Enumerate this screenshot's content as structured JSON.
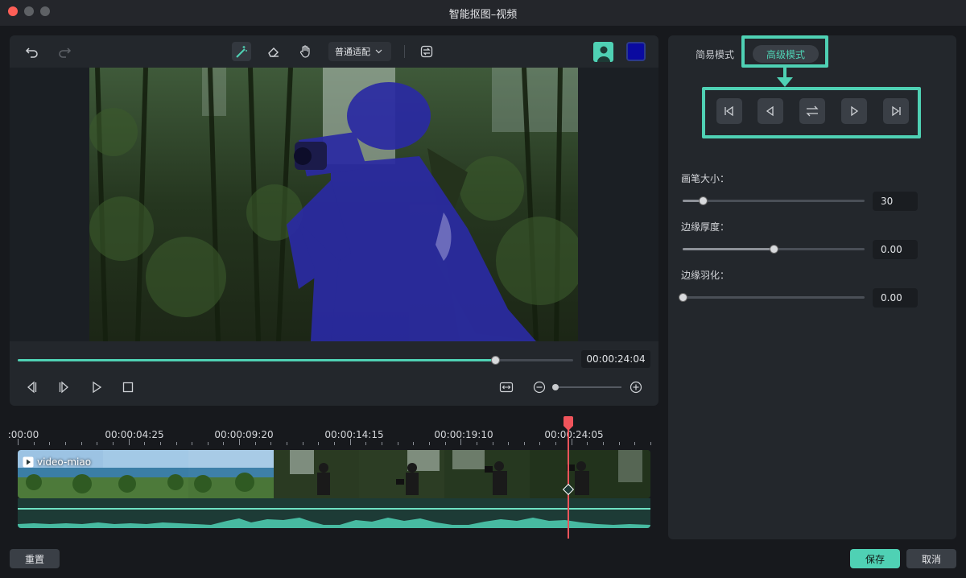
{
  "window": {
    "title": "智能抠图–视频",
    "traffic_lights": [
      "#fe5f57",
      "#5e6165",
      "#5e6165"
    ]
  },
  "toolbar": {
    "undo_icon": "undo-icon",
    "redo_icon": "redo-icon",
    "brush_icon": "smart-brush-icon",
    "eraser_icon": "eraser-icon",
    "hand_icon": "hand-icon",
    "fit_label": "普通适配",
    "swap_icon": "swap-icon",
    "person_icon": "person-icon",
    "mask_color": "#0a0aa0"
  },
  "player": {
    "progress": 0.86,
    "timecode": "00:00:24:04",
    "zoom_level": 0.0
  },
  "timeline": {
    "ruler_labels": [
      ":00:00",
      "00:00:04:25",
      "00:00:09:20",
      "00:00:14:15",
      "00:00:19:10",
      "00:00:24:05"
    ],
    "clip_name": "video-miao",
    "playhead": 0.87
  },
  "right_panel": {
    "mode_simple": "简易模式",
    "mode_advanced": "高级模式",
    "brush_size_label": "画笔大小：",
    "brush_size_value": "30",
    "brush_size_level": 0.11,
    "edge_thickness_label": "边缘厚度：",
    "edge_thickness_value": "0.00",
    "edge_thickness_level": 0.5,
    "edge_feather_label": "边缘羽化：",
    "edge_feather_value": "0.00",
    "edge_feather_level": 0.0
  },
  "footer": {
    "reset_label": "重置",
    "save_label": "保存",
    "cancel_label": "取消"
  },
  "colors": {
    "accent": "#4fd1b4",
    "playhead": "#f0545b"
  }
}
